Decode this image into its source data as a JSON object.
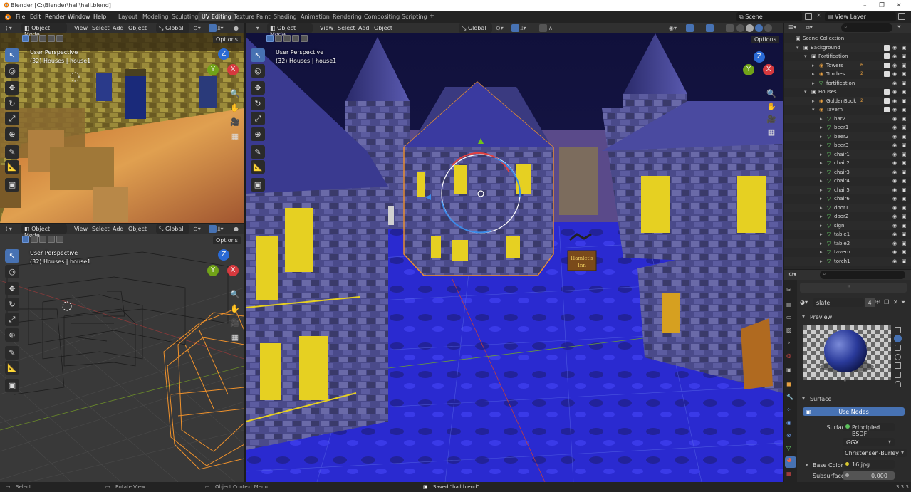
{
  "window": {
    "title": "Blender [C:\\Blender\\hall\\hall.blend]"
  },
  "menu": [
    "File",
    "Edit",
    "Render",
    "Window",
    "Help"
  ],
  "workspaces": [
    "Layout",
    "Modeling",
    "Sculpting",
    "UV Editing",
    "Texture Paint",
    "Shading",
    "Animation",
    "Rendering",
    "Compositing",
    "Scripting"
  ],
  "active_workspace": "UV Editing",
  "scene": {
    "label": "Scene"
  },
  "view_layer": {
    "label": "View Layer"
  },
  "viewport_header": {
    "mode": "Object Mode",
    "menus": [
      "View",
      "Select",
      "Add",
      "Object"
    ],
    "orientation": "Global",
    "options": "Options"
  },
  "viewports": [
    {
      "perspective": "User Perspective",
      "object": "(32) Houses | house1"
    },
    {
      "perspective": "User Perspective",
      "object": "(32) Houses | house1"
    },
    {
      "perspective": "User Perspective",
      "object": "(32) Houses | house1"
    }
  ],
  "gizmo_axes": {
    "x": "X",
    "y": "Y",
    "z": "Z"
  },
  "sign_text": {
    "line1": "Hamlet's",
    "line2": "Inn"
  },
  "outliner": {
    "rows": [
      {
        "label": "Scene Collection",
        "depth": 0,
        "type": "scene"
      },
      {
        "label": "Background",
        "depth": 1,
        "type": "collection"
      },
      {
        "label": "Fortification",
        "depth": 2,
        "type": "collection"
      },
      {
        "label": "Towers",
        "depth": 3,
        "type": "object",
        "badge": "6"
      },
      {
        "label": "Torches",
        "depth": 3,
        "type": "object",
        "badge": "2"
      },
      {
        "label": "fortification",
        "depth": 3,
        "type": "mesh"
      },
      {
        "label": "Houses",
        "depth": 2,
        "type": "collection"
      },
      {
        "label": "GoldenBook",
        "depth": 3,
        "type": "object",
        "badge": "2"
      },
      {
        "label": "Tavern",
        "depth": 3,
        "type": "object"
      },
      {
        "label": "bar2",
        "depth": 4,
        "type": "mesh"
      },
      {
        "label": "beer1",
        "depth": 4,
        "type": "mesh"
      },
      {
        "label": "beer2",
        "depth": 4,
        "type": "mesh"
      },
      {
        "label": "beer3",
        "depth": 4,
        "type": "mesh"
      },
      {
        "label": "chair1",
        "depth": 4,
        "type": "mesh"
      },
      {
        "label": "chair2",
        "depth": 4,
        "type": "mesh"
      },
      {
        "label": "chair3",
        "depth": 4,
        "type": "mesh"
      },
      {
        "label": "chair4",
        "depth": 4,
        "type": "mesh"
      },
      {
        "label": "chair5",
        "depth": 4,
        "type": "mesh"
      },
      {
        "label": "chair6",
        "depth": 4,
        "type": "mesh"
      },
      {
        "label": "door1",
        "depth": 4,
        "type": "mesh"
      },
      {
        "label": "door2",
        "depth": 4,
        "type": "mesh"
      },
      {
        "label": "sign",
        "depth": 4,
        "type": "mesh"
      },
      {
        "label": "table1",
        "depth": 4,
        "type": "mesh"
      },
      {
        "label": "table2",
        "depth": 4,
        "type": "mesh"
      },
      {
        "label": "tavern",
        "depth": 4,
        "type": "mesh"
      },
      {
        "label": "torch1",
        "depth": 4,
        "type": "mesh"
      }
    ]
  },
  "properties": {
    "material_name": "slate",
    "user_count": "4",
    "preview_label": "Preview",
    "surface_label": "Surface",
    "use_nodes": "Use Nodes",
    "surface_field": "Surface",
    "surface_value": "Principled BSDF",
    "distribution": "GGX",
    "subsurface_method": "Christensen-Burley",
    "base_color_label": "Base Color",
    "base_color_value": "16.jpg",
    "subsurface_label": "Subsurface",
    "subsurface_value": "0.000"
  },
  "status": {
    "left": "Select",
    "middle": "Rotate View",
    "right": "Object Context Menu",
    "message": "Saved \"hall.blend\"",
    "version": "3.3.3"
  },
  "colors": {
    "accent": "#4772b3",
    "selection": "#f0922c",
    "bg": "#1d1d1d"
  }
}
